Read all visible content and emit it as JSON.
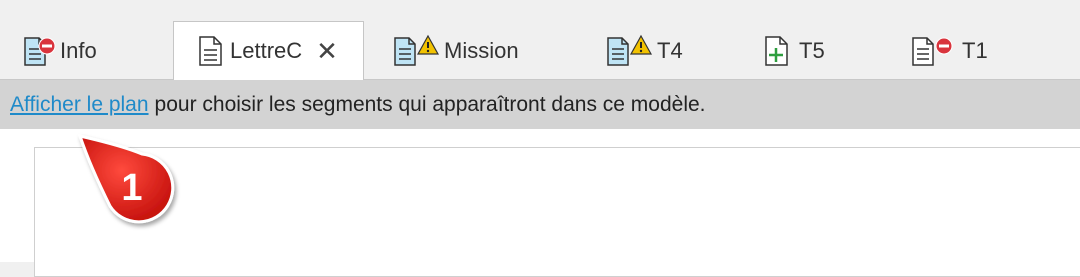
{
  "tabs": [
    {
      "label": "Info",
      "icon": "document-error-icon",
      "status": "error",
      "active": false
    },
    {
      "label": "LettreC",
      "icon": "document-icon",
      "status": "none",
      "active": true,
      "close": "✕"
    },
    {
      "label": "Mission",
      "icon": "document-warning-icon",
      "status": "warning",
      "active": false
    },
    {
      "label": "T4",
      "icon": "document-warning-icon",
      "status": "warning",
      "active": false
    },
    {
      "label": "T5",
      "icon": "document-add-icon",
      "status": "add",
      "active": false
    },
    {
      "label": "T1",
      "icon": "document-error-icon",
      "status": "error",
      "active": false
    }
  ],
  "infobar": {
    "link": "Afficher le plan",
    "text": "pour choisir les segments qui apparaîtront dans ce modèle."
  },
  "callout": {
    "number": "1",
    "color": "#e0201c"
  },
  "colors": {
    "link": "#1f8ac9",
    "error": "#d9343d",
    "warning": "#f2c200",
    "add": "#2e9e3f",
    "doc_blue": "#bfe4f5"
  }
}
